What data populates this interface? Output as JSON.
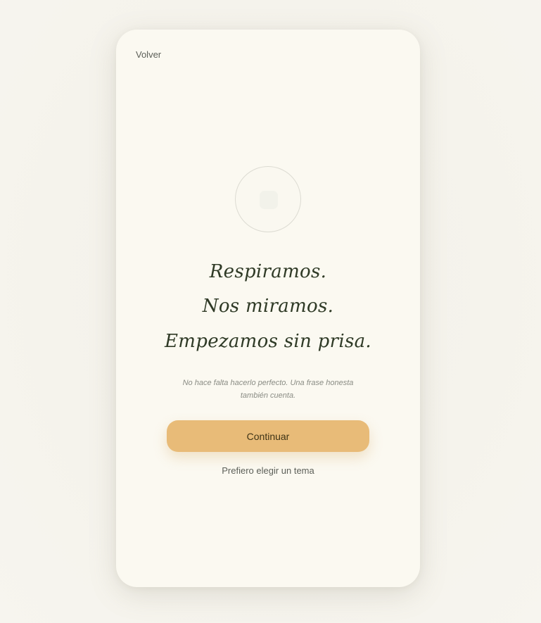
{
  "nav": {
    "back_label": "Volver"
  },
  "intro": {
    "lines": [
      "Respiramos.",
      "Nos miramos.",
      "Empezamos sin prisa."
    ],
    "note": "No hace falta hacerlo perfecto. Una frase honesta también cuenta."
  },
  "actions": {
    "primary_label": "Continuar",
    "secondary_label": "Prefiero elegir un tema"
  },
  "icons": {
    "center": "breathing-circle-icon"
  },
  "colors": {
    "background": "#f6f4ee",
    "card": "#fbf9f1",
    "headline": "#2f3a26",
    "accent": "#e8bb78"
  }
}
